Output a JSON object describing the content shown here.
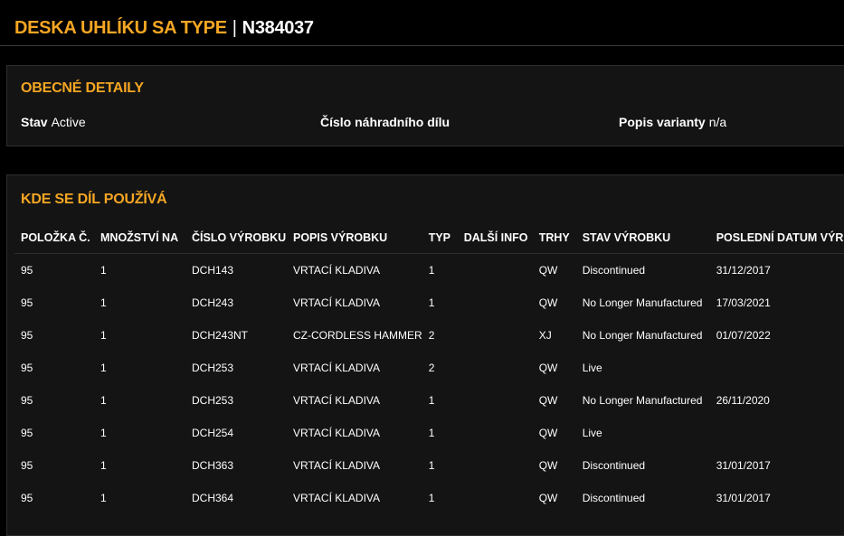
{
  "header": {
    "title_main": "DESKA UHLÍKU SA TYPE",
    "separator": "|",
    "part_id": "N384037"
  },
  "general": {
    "heading": "OBECNÉ DETAILY",
    "status_label": "Stav",
    "status_value": "Active",
    "spare_label": "Číslo náhradního dílu",
    "spare_value": "",
    "variant_label": "Popis varianty",
    "variant_value": "n/a"
  },
  "usage": {
    "heading": "KDE SE DÍL POUŽÍVÁ",
    "columns": [
      "POLOŽKA Č.",
      "MNOŽSTVÍ NA",
      "ČÍSLO VÝROBKU",
      "POPIS VÝROBKU",
      "TYP",
      "DALŠÍ INFO",
      "TRHY",
      "STAV VÝROBKU",
      "POSLEDNÍ DATUM VÝR."
    ],
    "rows": [
      [
        "95",
        "1",
        "DCH143",
        "VRTACÍ KLADIVA",
        "1",
        "",
        "QW",
        "Discontinued",
        "31/12/2017"
      ],
      [
        "95",
        "1",
        "DCH243",
        "VRTACÍ KLADIVA",
        "1",
        "",
        "QW",
        "No Longer Manufactured",
        "17/03/2021"
      ],
      [
        "95",
        "1",
        "DCH243NT",
        "CZ-CORDLESS HAMMER",
        "2",
        "",
        "XJ",
        "No Longer Manufactured",
        "01/07/2022"
      ],
      [
        "95",
        "1",
        "DCH253",
        "VRTACÍ KLADIVA",
        "2",
        "",
        "QW",
        "Live",
        ""
      ],
      [
        "95",
        "1",
        "DCH253",
        "VRTACÍ KLADIVA",
        "1",
        "",
        "QW",
        "No Longer Manufactured",
        "26/11/2020"
      ],
      [
        "95",
        "1",
        "DCH254",
        "VRTACÍ KLADIVA",
        "1",
        "",
        "QW",
        "Live",
        ""
      ],
      [
        "95",
        "1",
        "DCH363",
        "VRTACÍ KLADIVA",
        "1",
        "",
        "QW",
        "Discontinued",
        "31/01/2017"
      ],
      [
        "95",
        "1",
        "DCH364",
        "VRTACÍ KLADIVA",
        "1",
        "",
        "QW",
        "Discontinued",
        "31/01/2017"
      ]
    ]
  },
  "colors": {
    "accent": "#f5a623",
    "background": "#000000",
    "panel": "#141414"
  }
}
